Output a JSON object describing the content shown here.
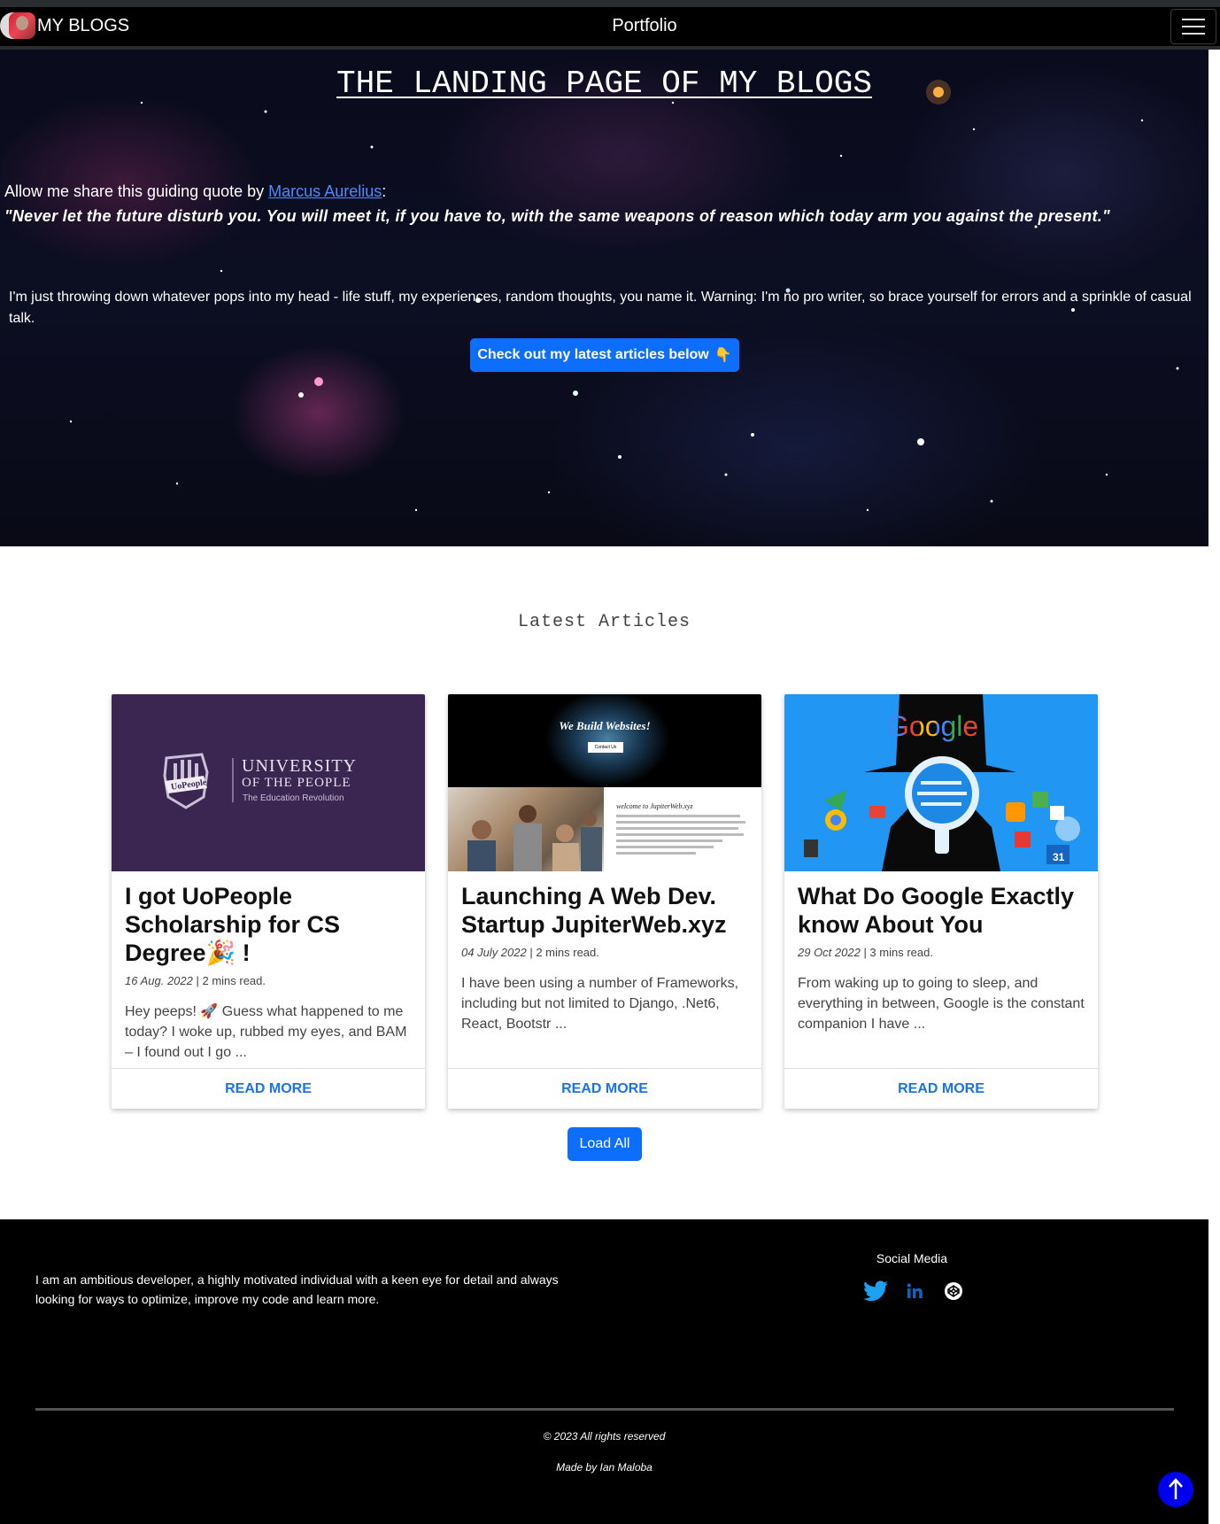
{
  "nav": {
    "brand": "MY BLOGS",
    "center_link": "Portfolio"
  },
  "hero": {
    "title": "THE LANDING PAGE OF MY BLOGS",
    "quote_intro_prefix": "Allow me share this guiding quote by ",
    "quote_author": "Marcus Aurelius",
    "quote_intro_suffix": ":",
    "quote": "\"Never let the future disturb you. You will meet it, if you have to, with the same weapons of reason which today arm you against the present.\"",
    "intro": "I'm just throwing down whatever pops into my head - life stuff, my experiences, random thoughts, you name it. Warning: I'm no pro writer, so brace yourself for errors and a sprinkle of casual talk.",
    "cta": "Check out my latest articles below"
  },
  "latest": {
    "heading": "Latest Articles",
    "articles": [
      {
        "title": "I got UoPeople Scholarship for CS Degree",
        "title_suffix": " !",
        "date": "16 Aug. 2022",
        "read_time": " | 2 mins read.",
        "excerpt": "Hey peeps! 🚀 Guess what happened to me today? I woke up, rubbed my eyes, and BAM – I found out I go ...",
        "cta": "READ MORE",
        "image": {
          "line1": "UNIVERSITY",
          "line2": "OF THE PEOPLE",
          "line3": "The Education Revolution",
          "badge": "UoPeople"
        }
      },
      {
        "title": "Launching A Web Dev. Startup JupiterWeb.xyz",
        "date": "04 July 2022",
        "read_time": " | 2 mins read.",
        "excerpt": "I have been using a number of Frameworks, including but not limited to Django, .Net6, React, Bootstr ...",
        "cta": "READ MORE",
        "image": {
          "banner": "We Build Websites!",
          "button": "Contact Us",
          "welcome": "welcome to JupiterWeb.xyz"
        }
      },
      {
        "title": "What Do Google Exactly know About You",
        "date": "29 Oct 2022",
        "read_time": " | 3 mins read.",
        "excerpt": "From waking up to going to sleep, and everything in between, Google is the constant companion I have ...",
        "cta": "READ MORE",
        "image": {
          "logo": "Google",
          "calendar_day": "31"
        }
      }
    ],
    "load_all": "Load All"
  },
  "footer": {
    "about": "I am an ambitious developer, a highly motivated individual with a keen eye for detail and always looking for ways to optimize, improve my code and learn more.",
    "social_title": "Social Media",
    "social": [
      "twitter-icon",
      "linkedin-icon",
      "codepen-icon"
    ],
    "copyright": "© 2023 All rights reserved",
    "made_by": "Made by Ian Maloba"
  },
  "colors": {
    "accent": "#0d6efd",
    "link": "#1a73e8",
    "navbar": "#000000",
    "footer": "#000000",
    "uopeople_purple": "#3b2551",
    "google_blue": "#2196f3",
    "twitter": "#1da1f2",
    "to_top": "#0000ee"
  }
}
